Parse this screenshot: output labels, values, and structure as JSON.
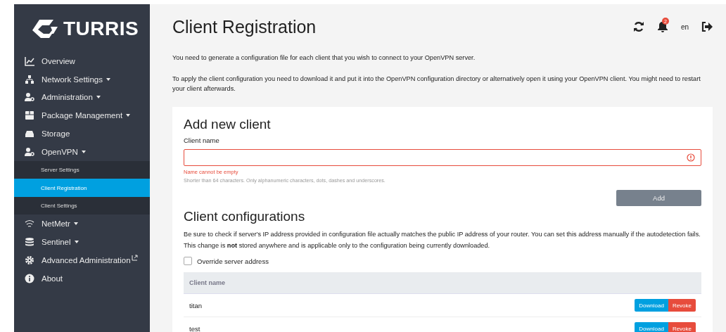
{
  "logo": {
    "text": "TURRIS"
  },
  "sidebar": {
    "items": [
      {
        "label": "Overview",
        "kind": "chart",
        "dropdown": false,
        "external": false
      },
      {
        "label": "Network Settings",
        "kind": "network",
        "dropdown": true,
        "external": false
      },
      {
        "label": "Administration",
        "kind": "usercog",
        "dropdown": true,
        "external": false
      },
      {
        "label": "Package Management",
        "kind": "box",
        "dropdown": true,
        "external": false
      },
      {
        "label": "Storage",
        "kind": "drive",
        "dropdown": false,
        "external": false
      },
      {
        "label": "OpenVPN",
        "kind": "usercog",
        "dropdown": true,
        "external": false,
        "children": [
          {
            "label": "Server Settings",
            "selected": false
          },
          {
            "label": "Client Registration",
            "selected": true
          },
          {
            "label": "Client Settings",
            "selected": false
          }
        ]
      },
      {
        "label": "NetMetr",
        "kind": "wifi",
        "dropdown": true,
        "external": false
      },
      {
        "label": "Sentinel",
        "kind": "db",
        "dropdown": true,
        "external": false
      },
      {
        "label": "Advanced Administration",
        "kind": "gear",
        "dropdown": false,
        "external": true
      },
      {
        "label": "About",
        "kind": "info",
        "dropdown": false,
        "external": false
      }
    ]
  },
  "header": {
    "title": "Client Registration",
    "notification_count": "2",
    "language": "en"
  },
  "intro": [
    "You need to generate a configuration file for each client that you wish to connect to your OpenVPN server.",
    "To apply the client configuration you need to download it and put it into the OpenVPN configuration directory or alternatively open it using your OpenVPN client. You might need to restart your client afterwards."
  ],
  "add_client": {
    "title": "Add new client",
    "field_label": "Client name",
    "invalid": true,
    "error": "Name cannot be empty",
    "hint": "Shorter than 64 characters. Only alphanumeric characters, dots, dashes and underscores.",
    "button": "Add",
    "button_disabled": true
  },
  "configurations": {
    "title": "Client configurations",
    "text": "Be sure to check if server's IP address provided in configuration file actually matches the public IP address of your router. You can set this address manually if the autodetection fails. This change is **not** stored anywhere and is applicable only to the configuration being currently downloaded.",
    "override": {
      "label": "Override server address",
      "checked": false
    },
    "table": {
      "columns": [
        "Client name"
      ],
      "rows": [
        {
          "name": "titan",
          "download": "Download",
          "revoke": "Revoke"
        },
        {
          "name": "test",
          "download": "Download",
          "revoke": "Revoke"
        }
      ]
    }
  }
}
